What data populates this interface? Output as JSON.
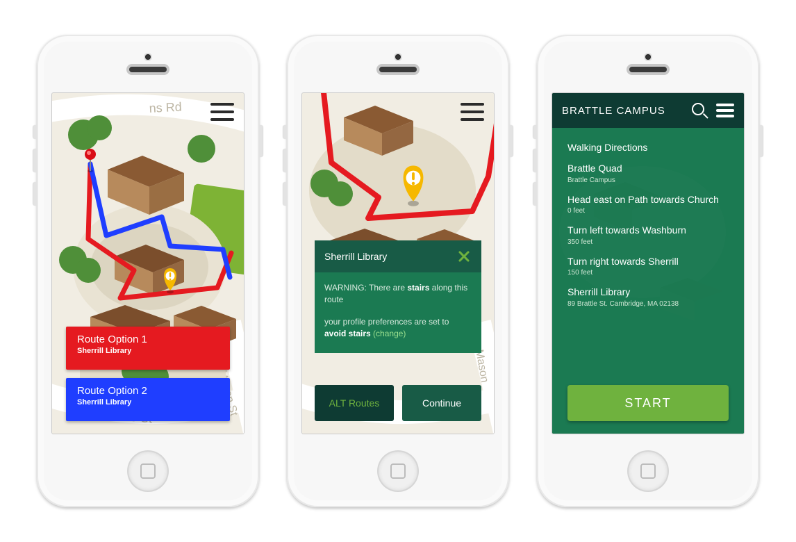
{
  "screen1": {
    "routes": [
      {
        "title": "Route Option 1",
        "subtitle": "Sherrill Library",
        "color_class": "red"
      },
      {
        "title": "Route Option 2",
        "subtitle": "Sherrill Library",
        "color_class": "blue"
      }
    ]
  },
  "screen2": {
    "header": "Sherrill Library",
    "warning_prefix": "WARNING: There are ",
    "warning_bold": "stairs",
    "warning_suffix": " along this route",
    "pref_prefix": "your profile preferences are set to ",
    "pref_bold": "avoid stairs",
    "pref_change": "(change)",
    "alt_button": "ALT Routes",
    "continue_button": "Continue"
  },
  "screen3": {
    "topbar_title": "BRATTLE CAMPUS",
    "section_title": "Walking Directions",
    "steps": [
      {
        "name": "Brattle Quad",
        "meta": "Brattle Campus"
      },
      {
        "name": "Head east on Path towards Church",
        "meta": "0 feet"
      },
      {
        "name": "Turn left towards Washburn",
        "meta": "350 feet"
      },
      {
        "name": "Turn right towards Sherrill",
        "meta": "150 feet"
      },
      {
        "name": "Sherrill Library",
        "meta": "89 Brattle St. Cambridge, MA 02138"
      }
    ],
    "start_button": "START"
  },
  "map": {
    "road_labels": [
      "ns Rd",
      "Brattle St",
      "Mason St"
    ]
  },
  "colors": {
    "route1": "#e51a20",
    "route2": "#1f3eff",
    "warning_pin": "#f6b800"
  }
}
